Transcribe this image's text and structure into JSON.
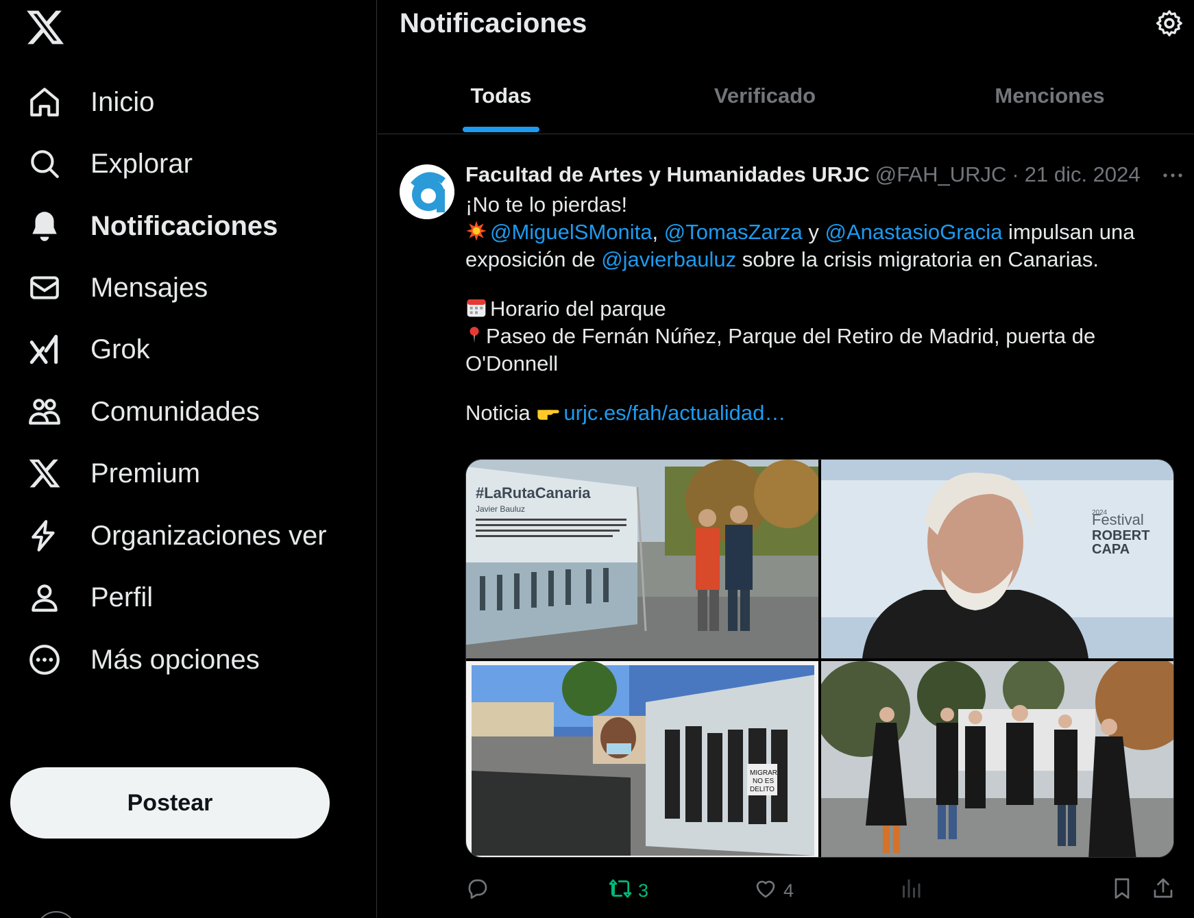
{
  "nav": {
    "items": [
      {
        "label": "Inicio",
        "icon": "home-icon"
      },
      {
        "label": "Explorar",
        "icon": "search-icon"
      },
      {
        "label": "Notificaciones",
        "icon": "bell-icon"
      },
      {
        "label": "Mensajes",
        "icon": "mail-icon"
      },
      {
        "label": "Grok",
        "icon": "grok-icon"
      },
      {
        "label": "Comunidades",
        "icon": "communities-icon"
      },
      {
        "label": "Premium",
        "icon": "x-premium-icon"
      },
      {
        "label": "Organizaciones ver",
        "icon": "lightning-icon"
      },
      {
        "label": "Perfil",
        "icon": "person-icon"
      },
      {
        "label": "Más opciones",
        "icon": "more-circle-icon"
      }
    ],
    "active": "Notificaciones",
    "post_label": "Postear"
  },
  "header": {
    "title": "Notificaciones",
    "tabs": [
      "Todas",
      "Verificado",
      "Menciones"
    ],
    "active_tab": "Todas"
  },
  "tweet": {
    "author": "Facultad de Artes y Humanidades URJC",
    "handle": "@FAH_URJC",
    "separator": "·",
    "date": "21 dic. 2024",
    "line1": "¡No te lo pierdas!",
    "mention1": "@MiguelSMonita",
    "comma": ",",
    "mention2": "@TomasZarza",
    "y": " y ",
    "mention3": "@AnastasioGracia",
    "line2_tail": " impulsan una",
    "line3_head": "exposición de ",
    "mention4": "@javierbauluz",
    "line3_tail": " sobre la crisis migratoria en Canarias.",
    "line4": "Horario del parque",
    "line5": "Paseo de Fernán Núñez, Parque del Retiro de Madrid, puerta de",
    "line6": "O'Donnell",
    "line7_head": "Noticia ",
    "link": "urjc.es/fah/actualidad…",
    "photo_texts": {
      "photo1_title": "#LaRutaCanaria",
      "photo1_sub": "Javier Bauluz",
      "photo2_festival": "Festival",
      "photo2_name1": "ROBERT",
      "photo2_name2": "CAPA",
      "photo2_year": "2024",
      "photo3_sign1": "MIGRAR",
      "photo3_sign2": "NO ES",
      "photo3_sign3": "DELITO"
    },
    "stats": {
      "replies": "",
      "retweets": "3",
      "likes": "4"
    }
  },
  "colors": {
    "accent": "#1d9bf0",
    "retweet": "#00ba7c",
    "muted": "#71767b",
    "text": "#e7e9ea",
    "border": "#2f3336"
  }
}
